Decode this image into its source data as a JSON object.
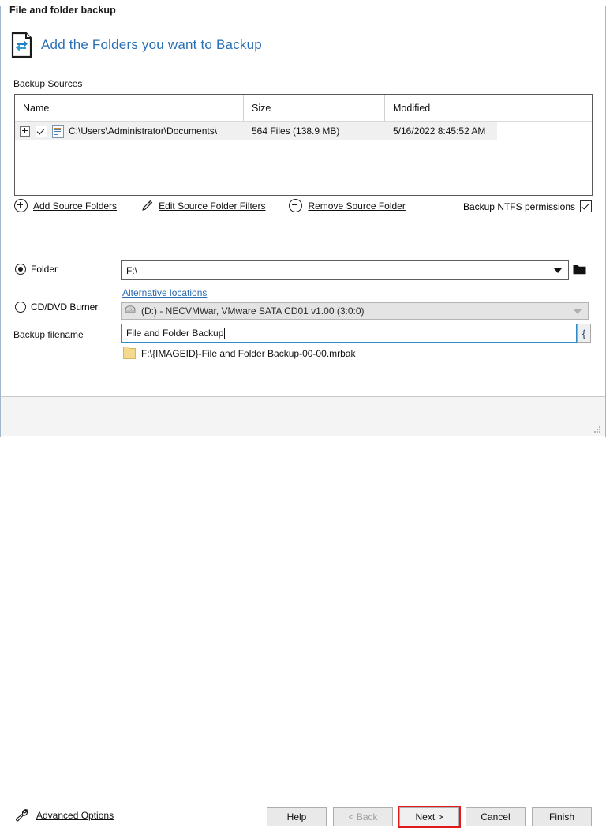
{
  "window": {
    "title": "File and folder backup"
  },
  "header": {
    "icon": "document-sync-icon",
    "title": "Add the Folders you want to Backup"
  },
  "sources": {
    "label": "Backup Sources",
    "columns": [
      "Name",
      "Size",
      "Modified"
    ],
    "rows": [
      {
        "expander": "+",
        "checked": true,
        "icon": "file-list-icon",
        "name": "C:\\Users\\Administrator\\Documents\\",
        "size": "564 Files (138.9 MB)",
        "modified": "5/16/2022 8:45:52 AM"
      }
    ],
    "actions": [
      {
        "id": "add-source-folders",
        "icon": "plus-circle-icon",
        "label": "Add Source Folders"
      },
      {
        "id": "edit-source-folder-filters",
        "icon": "pencil-icon",
        "label": "Edit Source Folder Filters"
      },
      {
        "id": "remove-source-folder",
        "icon": "minus-circle-icon",
        "label": "Remove Source Folder"
      }
    ],
    "ntfs": {
      "label": "Backup NTFS permissions",
      "checked": true
    }
  },
  "destination": {
    "folder_radio": {
      "label": "Folder",
      "selected": true
    },
    "folder_path": "F:\\",
    "alternative_locations": "Alternative locations",
    "cd_radio": {
      "label": "CD/DVD Burner",
      "selected": false
    },
    "cd_device": "(D:) - NECVMWar, VMware SATA CD01 v1.00 (3:0:0)",
    "filename_label": "Backup filename",
    "filename_value": "File and Folder Backup",
    "macro_button": "{",
    "preview": "F:\\{IMAGEID}-File and Folder Backup-00-00.mrbak"
  },
  "footer": {
    "advanced_options": "Advanced Options",
    "buttons": [
      {
        "id": "help",
        "label": "Help",
        "disabled": false,
        "highlighted": false
      },
      {
        "id": "back",
        "label": "< Back",
        "disabled": true,
        "highlighted": false
      },
      {
        "id": "next",
        "label": "Next >",
        "disabled": false,
        "highlighted": true
      },
      {
        "id": "cancel",
        "label": "Cancel",
        "disabled": false,
        "highlighted": false
      },
      {
        "id": "finish",
        "label": "Finish",
        "disabled": false,
        "highlighted": false
      }
    ]
  },
  "colors": {
    "accent_blue": "#2a6fb5",
    "link_blue": "#2b6cb0",
    "highlight_red": "#e01b1b",
    "row_selected_bg": "#f0f0f0"
  }
}
